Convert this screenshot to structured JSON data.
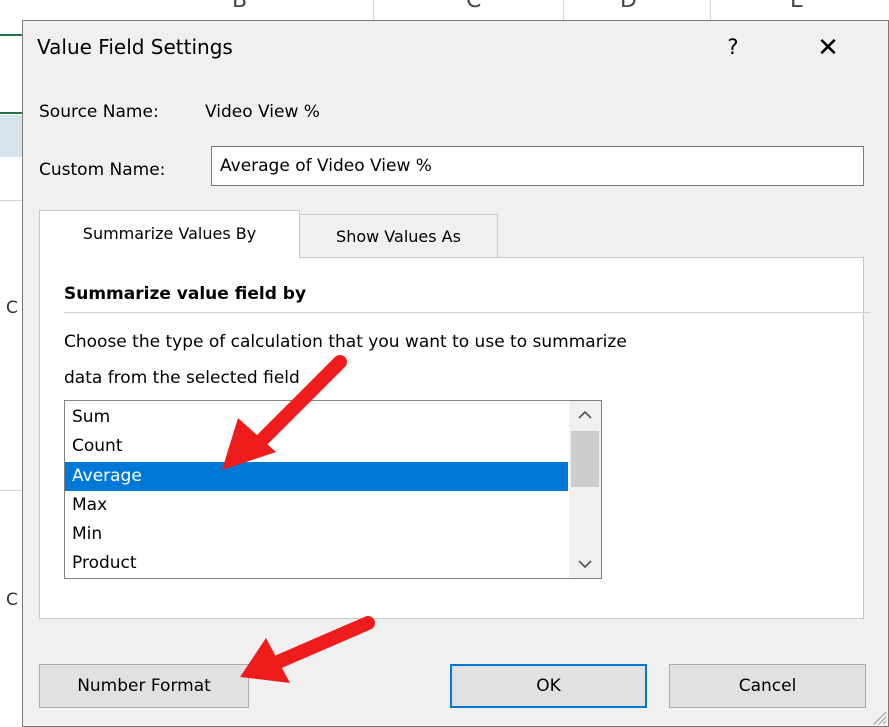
{
  "background_sheet": {
    "column_letters": [
      "B",
      "C",
      "D",
      "E"
    ],
    "row_letters": [
      "C",
      "C"
    ]
  },
  "dialog": {
    "title": "Value Field Settings",
    "help_glyph": "?",
    "close_glyph": "✕"
  },
  "source": {
    "label": "Source Name:",
    "value": "Video View %"
  },
  "custom_name": {
    "label": "Custom Name:",
    "value": "Average of Video View %"
  },
  "tabs": [
    {
      "label": "Summarize Values By",
      "active": true
    },
    {
      "label": "Show Values As",
      "active": false
    }
  ],
  "panel": {
    "heading": "Summarize value field by",
    "description_line1": "Choose the type of calculation that you want to use to summarize",
    "description_line2": "data from the selected field"
  },
  "listbox": {
    "items": [
      "Sum",
      "Count",
      "Average",
      "Max",
      "Min",
      "Product"
    ],
    "selected": "Average"
  },
  "buttons": {
    "number_format": "Number Format",
    "ok": "OK",
    "cancel": "Cancel"
  },
  "colors": {
    "selection": "#0078d7",
    "dialog_bg": "#f0f0f0",
    "annotation_arrow": "#ee1c1c"
  }
}
